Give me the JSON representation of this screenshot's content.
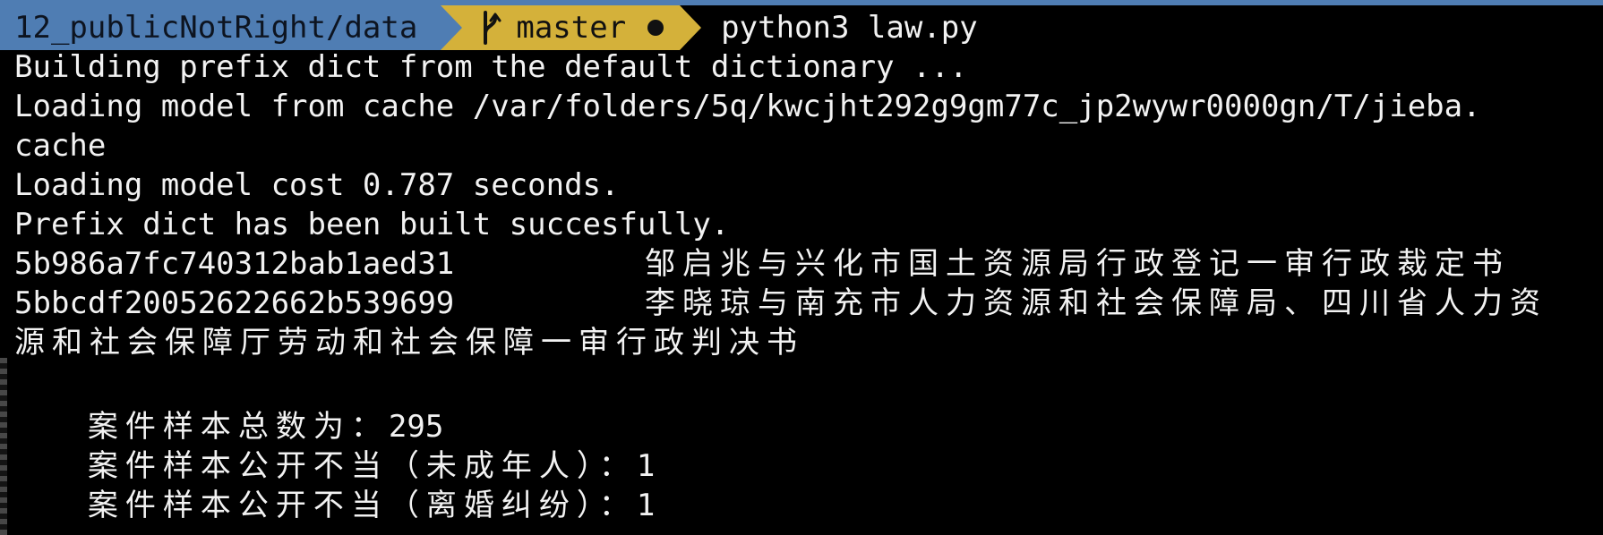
{
  "prompt": {
    "path": "12_publicNotRight/data",
    "branch": "master",
    "branch_icon": "git-branch-icon",
    "status_icon": "dirty-dot-icon",
    "command": "python3 law.py"
  },
  "output": {
    "line1": "Building prefix dict from the default dictionary ...",
    "line2": "Loading model from cache /var/folders/5q/kwcjht292g9gm77c_jp2wywr0000gn/T/jieba.",
    "line3": "cache",
    "line4": "Loading model cost 0.787 seconds.",
    "line5": "Prefix dict has been built succesfully.",
    "row1_id": "5b986a7fc740312bab1aed31",
    "row1_title": "邹启兆与兴化市国土资源局行政登记一审行政裁定书",
    "row2_id": "5bbcdf20052622662b539699",
    "row2_title_part1": "李晓琼与南充市人力资源和社会保障局、四川省人力资",
    "row2_title_part2": "源和社会保障厅劳动和社会保障一审行政判决书",
    "total_label": "案件样本总数为：",
    "total_value": "295",
    "minor_label": "案件样本公开不当（未成年人）：",
    "minor_value": "1",
    "divorce_label": "案件样本公开不当（离婚纠纷）：",
    "divorce_value": "1"
  },
  "colors": {
    "background": "#000000",
    "text": "#f2f2f2",
    "path_segment": "#4f7db3",
    "git_segment": "#d4b13a"
  }
}
